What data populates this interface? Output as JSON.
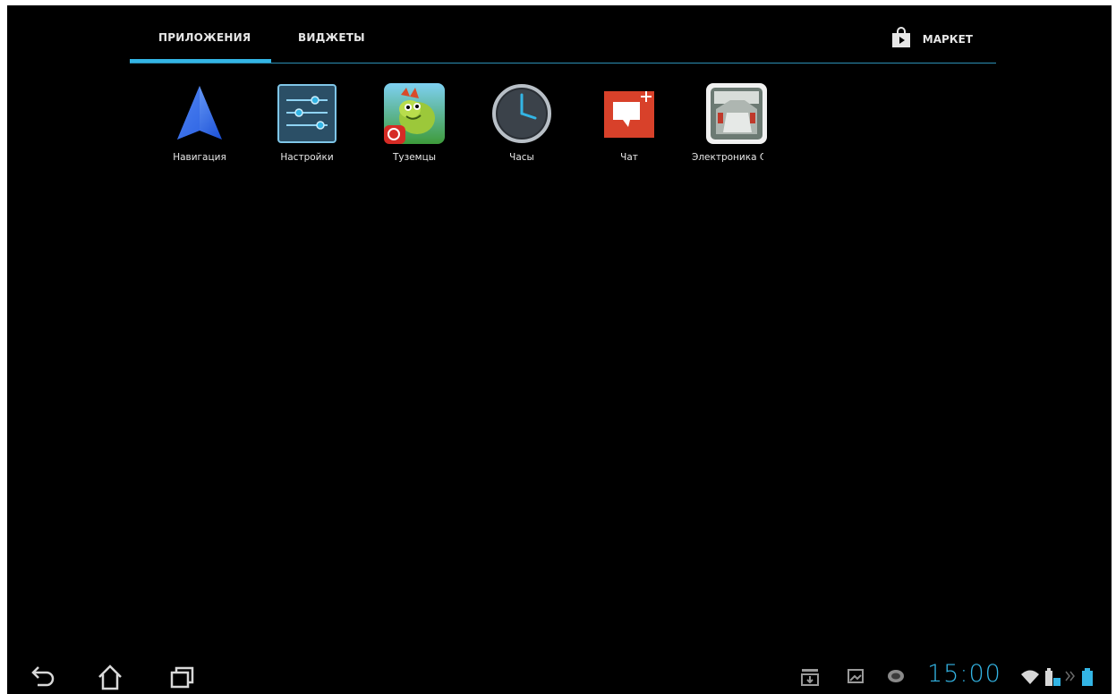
{
  "tabs": {
    "apps_label": "ПРИЛОЖЕНИЯ",
    "widgets_label": "ВИДЖЕТЫ",
    "active": "apps"
  },
  "market": {
    "label": "МАРКЕТ",
    "icon": "market-bag-icon"
  },
  "apps": [
    {
      "label": "Навигация",
      "icon": "navigation-arrow-icon"
    },
    {
      "label": "Настройки",
      "icon": "settings-sliders-icon"
    },
    {
      "label": "Туземцы",
      "icon": "tuzemtsy-game-icon"
    },
    {
      "label": "Часы",
      "icon": "clock-icon"
    },
    {
      "label": "Чат",
      "icon": "chat-bubble-icon"
    },
    {
      "label": "Электроника С",
      "icon": "electronics-app-icon"
    }
  ],
  "system_bar": {
    "time": "15:00",
    "buttons": [
      "back-icon",
      "home-icon",
      "recent-apps-icon"
    ],
    "status_icons": [
      "download-notification-icon",
      "screenshot-notification-icon",
      "es-app-notification-icon",
      "wifi-icon",
      "dock-battery-icon",
      "more-chevron-icon",
      "battery-icon"
    ]
  },
  "colors": {
    "accent": "#33b5e5",
    "background": "#000000",
    "text": "#e6e6e6"
  }
}
